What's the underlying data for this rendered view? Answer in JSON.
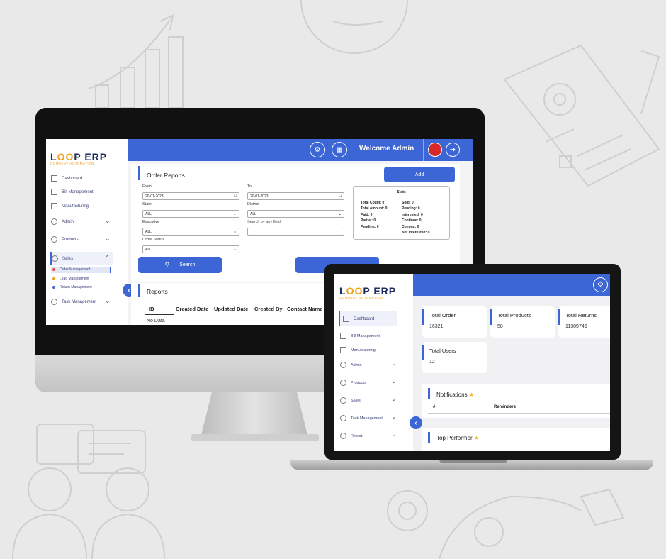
{
  "colors": {
    "brand_blue": "#3c66d6",
    "logo_navy": "#1d2b5c",
    "logo_orange": "#f0a11b",
    "background": "#e9e9e9"
  },
  "logo": {
    "text_left": "L",
    "text_loop": "OO",
    "text_right": "P ERP",
    "subtitle": "COMPANY AUTOMATION"
  },
  "desktop": {
    "sidebar": {
      "items": [
        {
          "label": "Dashboard",
          "icon": "grid-icon"
        },
        {
          "label": "Bill Management",
          "icon": "bill-icon"
        },
        {
          "label": "Manufacturing",
          "icon": "factory-icon"
        },
        {
          "label": "Admin",
          "icon": "admin-icon"
        },
        {
          "label": "Products",
          "icon": "products-icon"
        },
        {
          "label": "Sales",
          "icon": "sales-icon"
        },
        {
          "label": "Task Management",
          "icon": "task-icon"
        }
      ],
      "sales_submenu": [
        {
          "label": "Order Management",
          "color": "#e74c3c"
        },
        {
          "label": "Lead Management",
          "color": "#f0a11b"
        },
        {
          "label": "Return Management",
          "color": "#3c66d6"
        }
      ]
    },
    "topbar": {
      "welcome": "Welcome Admin"
    },
    "order_reports": {
      "title": "Order Reports",
      "add_label": "Add",
      "from_label": "From",
      "from_value": "20-01-2023",
      "to_label": "To",
      "to_value": "20-01-2023",
      "state_label": "State",
      "state_value": "ALL",
      "district_label": "District",
      "district_value": "ALL",
      "executive_label": "Executive",
      "executive_value": "ALL",
      "search_field_label": "Search by any field",
      "order_status_label": "Order Status",
      "order_status_value": "ALL",
      "search_button": "Search"
    },
    "stats": {
      "title": "Stats",
      "left": [
        "Total Count: 0",
        "Total Amount: 0",
        "Paid: 0",
        "Partial: 0",
        "Pending: 0"
      ],
      "right": [
        "Sold: 0",
        "Pending: 0",
        "Interested: 0",
        "Continue: 0",
        "Coming: 0",
        "Not Interested: 0"
      ]
    },
    "reports": {
      "title": "Reports",
      "columns": [
        "ID",
        "Created Date",
        "Updated Date",
        "Created By",
        "Contact Name"
      ],
      "empty_text": "No Data"
    }
  },
  "laptop": {
    "sidebar": {
      "items": [
        {
          "label": "Dashboard",
          "icon": "grid-icon"
        },
        {
          "label": "Bill Management",
          "icon": "bill-icon"
        },
        {
          "label": "Manufacturing",
          "icon": "factory-icon"
        },
        {
          "label": "Admin",
          "icon": "admin-icon"
        },
        {
          "label": "Products",
          "icon": "products-icon"
        },
        {
          "label": "Sales",
          "icon": "sales-icon"
        },
        {
          "label": "Task Management",
          "icon": "task-icon"
        },
        {
          "label": "Report",
          "icon": "report-icon"
        }
      ]
    },
    "kpis": [
      {
        "title": "Total Order",
        "value": "16321"
      },
      {
        "title": "Total Products",
        "value": "58"
      },
      {
        "title": "Total Returns",
        "value": "11309746"
      },
      {
        "title": "Total Users",
        "value": "12"
      }
    ],
    "notifications": {
      "title": "Notifications",
      "col_hash": "#",
      "col_reminders": "Reminders"
    },
    "top_performer": {
      "title": "Top Performer"
    }
  }
}
